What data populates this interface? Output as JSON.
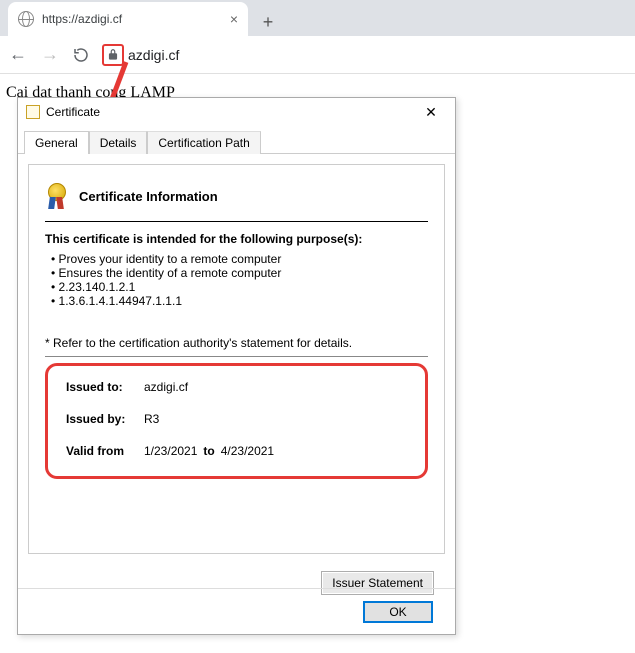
{
  "browser": {
    "tab_title": "https://azdigi.cf",
    "url_display": "azdigi.cf",
    "page_text": "Cai dat thanh cong LAMP"
  },
  "dialog": {
    "title": "Certificate",
    "tabs": {
      "general": "General",
      "details": "Details",
      "certpath": "Certification Path"
    },
    "cert_info_heading": "Certificate Information",
    "purpose_heading": "This certificate is intended for the following purpose(s):",
    "purposes": [
      "Proves your identity to a remote computer",
      "Ensures the identity of a remote computer",
      "2.23.140.1.2.1",
      "1.3.6.1.4.1.44947.1.1.1"
    ],
    "refer_note": "* Refer to the certification authority's statement for details.",
    "issued_to_label": "Issued to:",
    "issued_to": "azdigi.cf",
    "issued_by_label": "Issued by:",
    "issued_by": "R3",
    "valid_from_label": "Valid from",
    "valid_from": "1/23/2021",
    "valid_to_word": "to",
    "valid_to": "4/23/2021",
    "issuer_statement_btn": "Issuer Statement",
    "ok_btn": "OK"
  },
  "colors": {
    "annotation": "#e53935",
    "ok_focus": "#0078d7"
  }
}
